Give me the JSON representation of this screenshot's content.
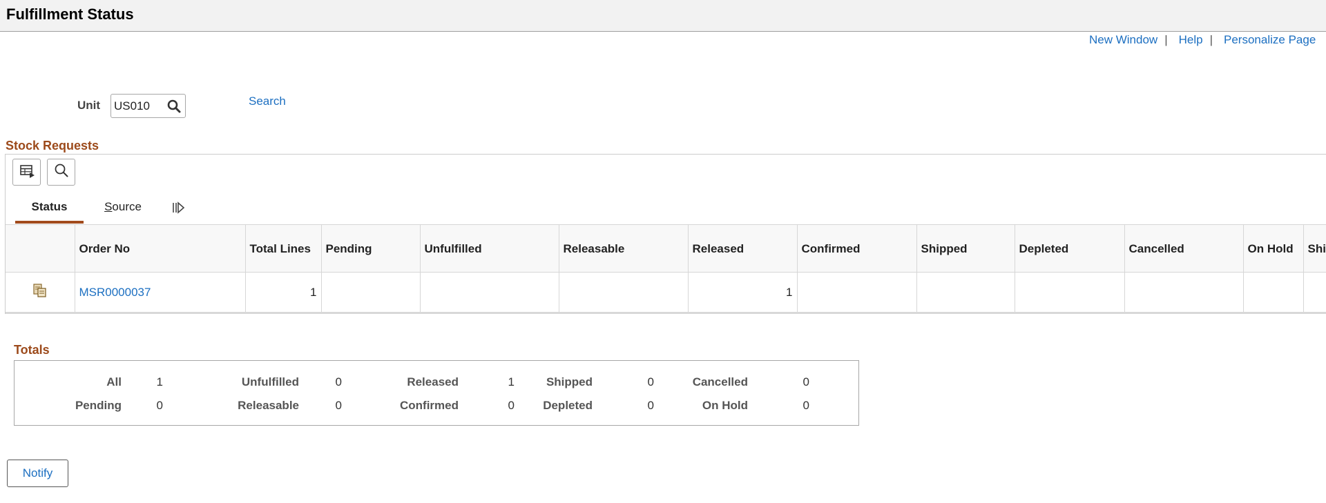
{
  "header": {
    "title": "Fulfillment Status"
  },
  "toplinks": {
    "new_window": "New Window",
    "help": "Help",
    "personalize": "Personalize Page"
  },
  "search_form": {
    "unit_label": "Unit",
    "unit_value": "US010",
    "search_link": "Search"
  },
  "stock_requests": {
    "section_title": "Stock Requests",
    "tabs": [
      {
        "label": "Status",
        "active": true
      },
      {
        "label": "Source",
        "active": false
      }
    ],
    "columns": [
      "Order No",
      "Total Lines",
      "Pending",
      "Unfulfilled",
      "Releasable",
      "Released",
      "Confirmed",
      "Shipped",
      "Depleted",
      "Cancelled",
      "On Hold",
      "Shi"
    ],
    "rows": [
      {
        "order_no": "MSR0000037",
        "total_lines": "1",
        "pending": "",
        "unfulfilled": "",
        "releasable": "",
        "released": "1",
        "confirmed": "",
        "shipped": "",
        "depleted": "",
        "cancelled": "",
        "on_hold": "",
        "shi": ""
      }
    ]
  },
  "totals": {
    "section_title": "Totals",
    "items": [
      {
        "label": "All",
        "value": "1"
      },
      {
        "label": "Unfulfilled",
        "value": "0"
      },
      {
        "label": "Released",
        "value": "1"
      },
      {
        "label": "Shipped",
        "value": "0"
      },
      {
        "label": "Cancelled",
        "value": "0"
      },
      {
        "label": "Pending",
        "value": "0"
      },
      {
        "label": "Releasable",
        "value": "0"
      },
      {
        "label": "Confirmed",
        "value": "0"
      },
      {
        "label": "Depleted",
        "value": "0"
      },
      {
        "label": "On Hold",
        "value": "0"
      }
    ]
  },
  "actions": {
    "notify": "Notify"
  },
  "colors": {
    "link": "#1c6fc1",
    "section_title": "#9c4a1b",
    "tab_active": "#a24b1c"
  }
}
